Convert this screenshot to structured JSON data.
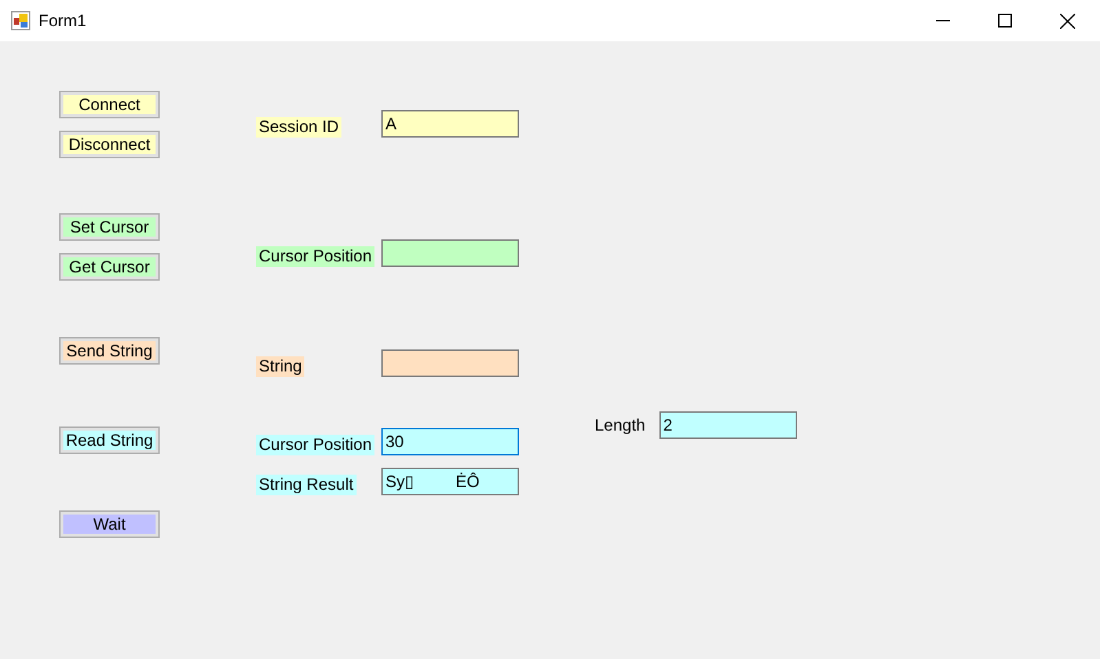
{
  "window": {
    "title": "Form1"
  },
  "buttons": [
    {
      "label": "Connect",
      "color": "#ffffc0"
    },
    {
      "label": "Disconnect",
      "color": "#ffffc0"
    },
    {
      "label": "Set Cursor",
      "color": "#c0ffc0"
    },
    {
      "label": "Get Cursor",
      "color": "#c0ffc0"
    },
    {
      "label": "Send String",
      "color": "#ffe0c0"
    },
    {
      "label": "Read String",
      "color": "#c0ffff"
    },
    {
      "label": "Wait",
      "color": "#c0c0ff"
    }
  ],
  "fields": [
    {
      "label": "Session ID",
      "color": "#ffffc0",
      "value": "A",
      "focused": false
    },
    {
      "label": "Cursor Position",
      "color": "#c0ffc0",
      "focused": false
    },
    {
      "label": "String",
      "color": "#ffe0c0",
      "focused": false
    },
    {
      "label": "Cursor Position",
      "color": "#c0ffff",
      "value": "30",
      "focused": true
    },
    {
      "label": "String Result",
      "color": "#c0ffff",
      "value": "Sy▯         ĖÔ",
      "focused": false
    }
  ],
  "length": {
    "label": "Length",
    "value": "2",
    "color": "#c0ffff"
  }
}
